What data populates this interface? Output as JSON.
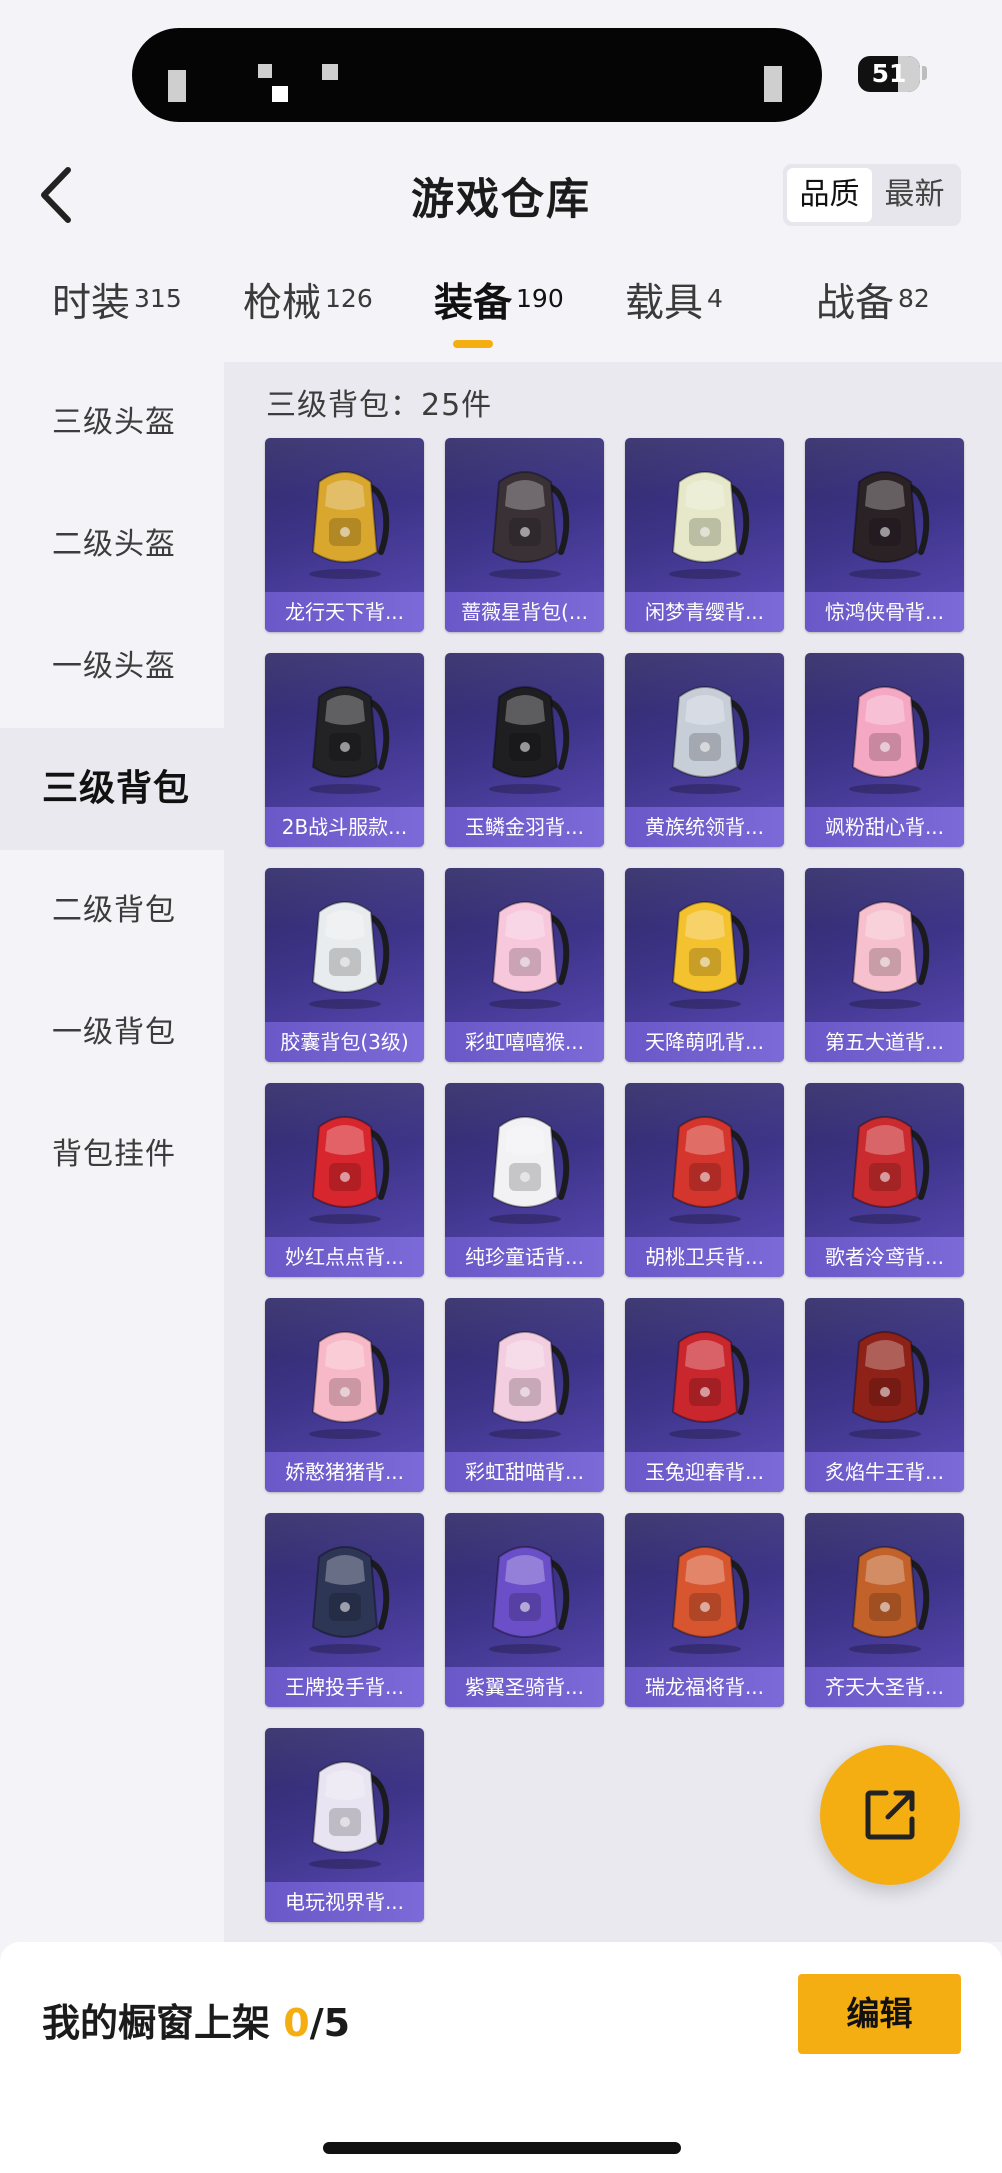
{
  "status": {
    "battery": "51"
  },
  "header": {
    "title": "游戏仓库",
    "sort": [
      "品质",
      "最新"
    ]
  },
  "tabs": [
    {
      "label": "时装",
      "count": "315"
    },
    {
      "label": "枪械",
      "count": "126"
    },
    {
      "label": "装备",
      "count": "190"
    },
    {
      "label": "载具",
      "count": "4"
    },
    {
      "label": "战备",
      "count": "82"
    }
  ],
  "sidebar": {
    "items": [
      {
        "label": "三级头盔"
      },
      {
        "label": "二级头盔"
      },
      {
        "label": "一级头盔"
      },
      {
        "label": "三级背包"
      },
      {
        "label": "二级背包"
      },
      {
        "label": "一级背包"
      },
      {
        "label": "背包挂件"
      }
    ]
  },
  "section": {
    "title": "三级背包：25件"
  },
  "items": [
    {
      "name": "龙行天下背...",
      "color": "#d9a62e",
      "icon": "dragon-backpack-icon"
    },
    {
      "name": "蔷薇星背包(...",
      "color": "#3a3136",
      "icon": "rose-star-backpack-icon"
    },
    {
      "name": "闲梦青缨背...",
      "color": "#e6e8c9",
      "icon": "dream-backpack-icon"
    },
    {
      "name": "惊鸿侠骨背...",
      "color": "#2b2226",
      "icon": "swordsman-backpack-icon"
    },
    {
      "name": "2B战斗服款...",
      "color": "#232326",
      "icon": "2b-backpack-icon"
    },
    {
      "name": "玉鳞金羽背...",
      "color": "#1f1f22",
      "icon": "jade-scale-backpack-icon"
    },
    {
      "name": "黄族统领背...",
      "color": "#c8ced8",
      "icon": "commander-backpack-icon"
    },
    {
      "name": "飒粉甜心背...",
      "color": "#f5a8c4",
      "icon": "pink-sweet-backpack-icon"
    },
    {
      "name": "胶囊背包(3级)",
      "color": "#e9ecee",
      "icon": "capsule-backpack-icon"
    },
    {
      "name": "彩虹嘻嘻猴...",
      "color": "#f7c7dc",
      "icon": "rainbow-monkey-backpack-icon"
    },
    {
      "name": "天降萌吼背...",
      "color": "#f4c12f",
      "icon": "cute-roar-backpack-icon"
    },
    {
      "name": "第五大道背...",
      "color": "#f6c0ce",
      "icon": "fifth-avenue-backpack-icon"
    },
    {
      "name": "妙红点点背...",
      "color": "#d8262e",
      "icon": "red-dots-backpack-icon"
    },
    {
      "name": "纯珍童话背...",
      "color": "#f2f2f4",
      "icon": "fairy-tale-backpack-icon"
    },
    {
      "name": "胡桃卫兵背...",
      "color": "#d4352c",
      "icon": "nutcracker-backpack-icon"
    },
    {
      "name": "歌者泠鸢背...",
      "color": "#c92b2e",
      "icon": "singer-backpack-icon"
    },
    {
      "name": "娇憨猪猪背...",
      "color": "#f7b9c7",
      "icon": "piggy-backpack-icon"
    },
    {
      "name": "彩虹甜喵背...",
      "color": "#f3cde0",
      "icon": "rainbow-cat-backpack-icon"
    },
    {
      "name": "玉兔迎春背...",
      "color": "#c9262d",
      "icon": "jade-rabbit-backpack-icon"
    },
    {
      "name": "炙焰牛王背...",
      "color": "#8f2218",
      "icon": "bull-king-backpack-icon"
    },
    {
      "name": "王牌投手背...",
      "color": "#2e3656",
      "icon": "ace-pitcher-backpack-icon"
    },
    {
      "name": "紫翼圣骑背...",
      "color": "#6b4fc9",
      "icon": "purple-knight-backpack-icon"
    },
    {
      "name": "瑞龙福将背...",
      "color": "#d8562f",
      "icon": "lucky-dragon-backpack-icon"
    },
    {
      "name": "齐天大圣背...",
      "color": "#c2612a",
      "icon": "monkey-king-backpack-icon"
    },
    {
      "name": "电玩视界背...",
      "color": "#e9e4f1",
      "icon": "gamer-backpack-icon"
    }
  ],
  "showcase": {
    "label": "我的橱窗上架 ",
    "current": "0",
    "total": "/5"
  },
  "edit_label": "编辑",
  "colors": {
    "accent": "#f5ae12",
    "card_top": "#2f2a66",
    "card_bottom": "#5c4ab8"
  }
}
